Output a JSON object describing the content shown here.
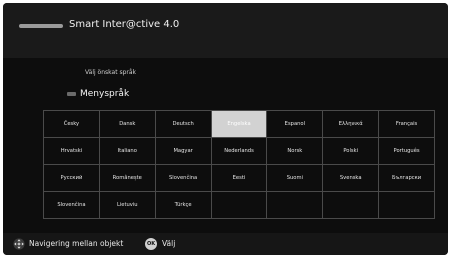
{
  "header": {
    "title": "Smart Inter@ctive 4.0"
  },
  "prompt": "Välj önskat språk",
  "menu": {
    "label": "Menyspråk"
  },
  "languages": [
    "Česky",
    "Dansk",
    "Deutsch",
    "Engelska",
    "Espanol",
    "Ελληνικά",
    "Français",
    "Hrvatski",
    "Italiano",
    "Magyar",
    "Nederlands",
    "Norsk",
    "Polski",
    "Português",
    "Русский",
    "Românește",
    "Slovenčina",
    "Eesti",
    "Suomi",
    "Svenska",
    "Български",
    "Slovenčina",
    "Lietuviu",
    "Türkçe",
    "",
    "",
    "",
    ""
  ],
  "selected_language": "Engelska",
  "footer": {
    "nav_label": "Navigering mellan objekt",
    "ok_icon": "OK",
    "ok_label": "Välj"
  },
  "icons": {
    "brand": "brand-logo",
    "menu": "menu-icon",
    "navigate": "dpad-icon",
    "ok": "ok-icon"
  },
  "colors": {
    "background": "#0d0d0d",
    "header": "#1a1a1a",
    "text": "#e6e6e6",
    "selected": "#d2d2d2",
    "grid_line": "#4a4a4a"
  }
}
